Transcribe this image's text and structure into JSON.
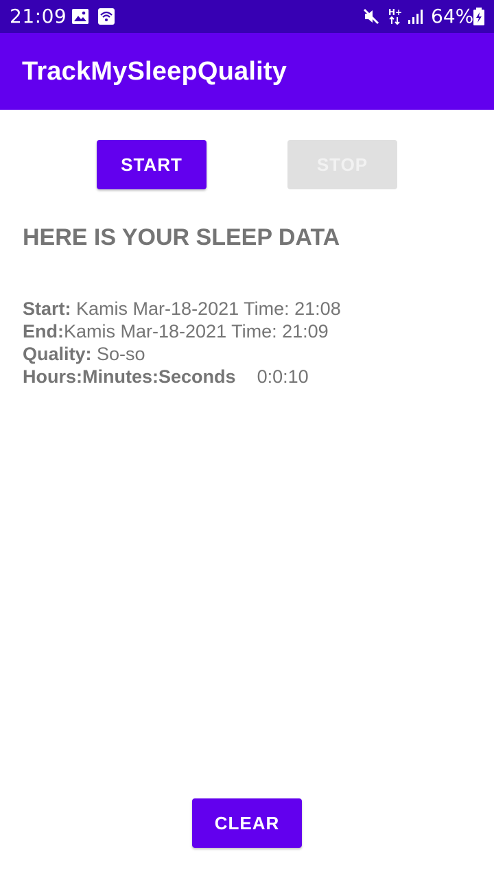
{
  "status_bar": {
    "time": "21:09",
    "battery_percent": "64%",
    "icons": [
      "image-icon",
      "wifi-icon",
      "mute-icon",
      "network-h-plus-icon",
      "signal-icon",
      "battery-icon"
    ],
    "background_color": "#3700b3"
  },
  "app_bar": {
    "title": "TrackMySleepQuality",
    "background_color": "#6200ee"
  },
  "controls": {
    "start_label": "START",
    "stop_label": "STOP",
    "stop_enabled": false,
    "clear_label": "CLEAR"
  },
  "main": {
    "heading": "HERE IS YOUR SLEEP DATA",
    "sleep_data": {
      "start_label": "Start:",
      "start_value": "Kamis Mar-18-2021 Time: 21:08",
      "end_label": "End:",
      "end_value": "Kamis Mar-18-2021 Time: 21:09",
      "quality_label": "Quality:",
      "quality_value": "So-so",
      "duration_label": "Hours:Minutes:Seconds",
      "duration_value": "0:0:10"
    }
  },
  "colors": {
    "accent": "#6200ee",
    "text_secondary": "#757575",
    "disabled": "#e0e0e0"
  }
}
